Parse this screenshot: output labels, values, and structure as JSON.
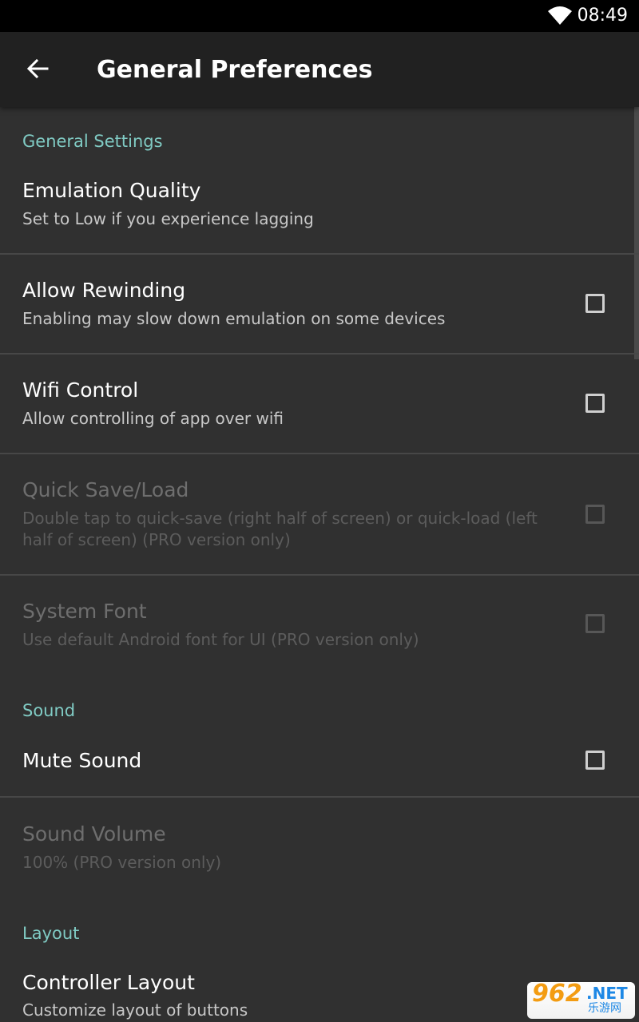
{
  "status_bar": {
    "time": "08:49",
    "wifi_icon": "wifi-icon"
  },
  "app_bar": {
    "back_icon": "arrow-left-icon",
    "title": "General Preferences"
  },
  "sections": [
    {
      "header": "General Settings",
      "items": [
        {
          "title": "Emulation Quality",
          "summary": "Set to Low if you experience lagging",
          "checkbox": null,
          "enabled": true
        },
        {
          "title": "Allow Rewinding",
          "summary": "Enabling may slow down emulation on some devices",
          "checkbox": false,
          "enabled": true
        },
        {
          "title": "Wifi Control",
          "summary": "Allow controlling of app over wifi",
          "checkbox": false,
          "enabled": true
        },
        {
          "title": "Quick Save/Load",
          "summary": "Double tap to quick-save (right half of screen) or quick-load (left half of screen) (PRO version only)",
          "checkbox": false,
          "enabled": false
        },
        {
          "title": "System Font",
          "summary": "Use default Android font for UI (PRO version only)",
          "checkbox": false,
          "enabled": false
        }
      ]
    },
    {
      "header": "Sound",
      "items": [
        {
          "title": "Mute Sound",
          "checkbox": false,
          "enabled": true
        },
        {
          "title": "Sound Volume",
          "summary": "100% (PRO version only)",
          "checkbox": null,
          "enabled": false
        }
      ]
    },
    {
      "header": "Layout",
      "items": [
        {
          "title": "Controller Layout",
          "summary": "Customize layout of buttons",
          "checkbox": null,
          "enabled": true
        }
      ]
    }
  ],
  "watermark": {
    "number": "962",
    "suffix": ".NET",
    "chinese": "乐游网"
  },
  "colors": {
    "accent": "#80cbc4",
    "background": "#303030",
    "appbar": "#212121"
  }
}
